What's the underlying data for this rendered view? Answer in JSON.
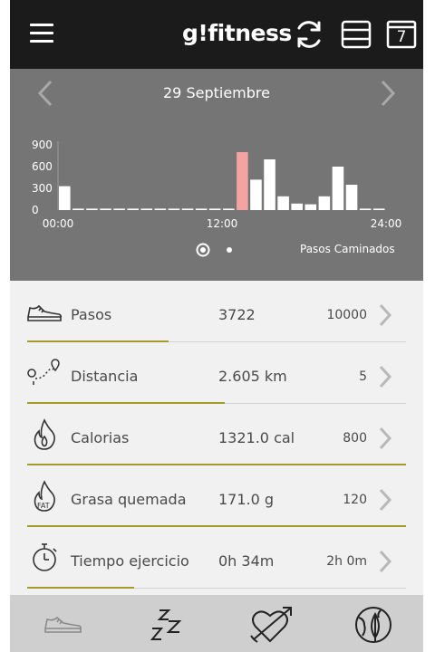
{
  "header": {
    "logo": "g!fitness",
    "icons": [
      "menu-icon",
      "sync-icon",
      "layout-icon",
      "calendar-icon"
    ],
    "calendar_day": "7"
  },
  "chart_header": {
    "date": "29 Septiembre",
    "metric_label": "Pasos Caminados"
  },
  "chart_data": {
    "type": "bar",
    "y_ticks": [
      "900",
      "600",
      "300",
      "0"
    ],
    "x_ticks": [
      "00:00",
      "12:00",
      "24:00"
    ],
    "ylim": [
      0,
      900
    ],
    "values": [
      330,
      20,
      20,
      20,
      20,
      20,
      20,
      20,
      20,
      20,
      20,
      20,
      20,
      800,
      420,
      700,
      190,
      90,
      80,
      190,
      600,
      350,
      20,
      20
    ],
    "highlight_index": 13,
    "bar_color": "#ffffff",
    "highlight_color": "#f4a3a3"
  },
  "pager": {
    "pages": 2,
    "active": 0
  },
  "metrics": [
    {
      "id": "pasos",
      "label": "Pasos",
      "value": "3722",
      "goal": "10000",
      "icon": "shoe-icon",
      "progress": 0.3722
    },
    {
      "id": "distancia",
      "label": "Distancia",
      "value": "2.605 km",
      "goal": "5",
      "icon": "route-pin-icon",
      "progress": 0.521
    },
    {
      "id": "calorias",
      "label": "Calorias",
      "value": "1321.0 cal",
      "goal": "800",
      "icon": "flame-icon",
      "progress": 1.0
    },
    {
      "id": "grasa",
      "label": "Grasa quemada",
      "value": "171.0 g",
      "goal": "120",
      "icon": "fat-flame-icon",
      "progress": 1.0
    },
    {
      "id": "tiempo",
      "label": "Tiempo ejercicio",
      "value": "0h 34m",
      "goal": "2h 0m",
      "icon": "stopwatch-icon",
      "progress": 0.283
    }
  ],
  "bottom_nav": [
    "shoe-tab-icon",
    "sleep-tab-icon",
    "heart-tab-icon",
    "globe-leaf-tab-icon"
  ],
  "colors": {
    "accent": "#a59a2a",
    "header_bg": "#1b1b1b",
    "panel_bg": "#767575",
    "nav_bg": "#cfcfcf"
  }
}
